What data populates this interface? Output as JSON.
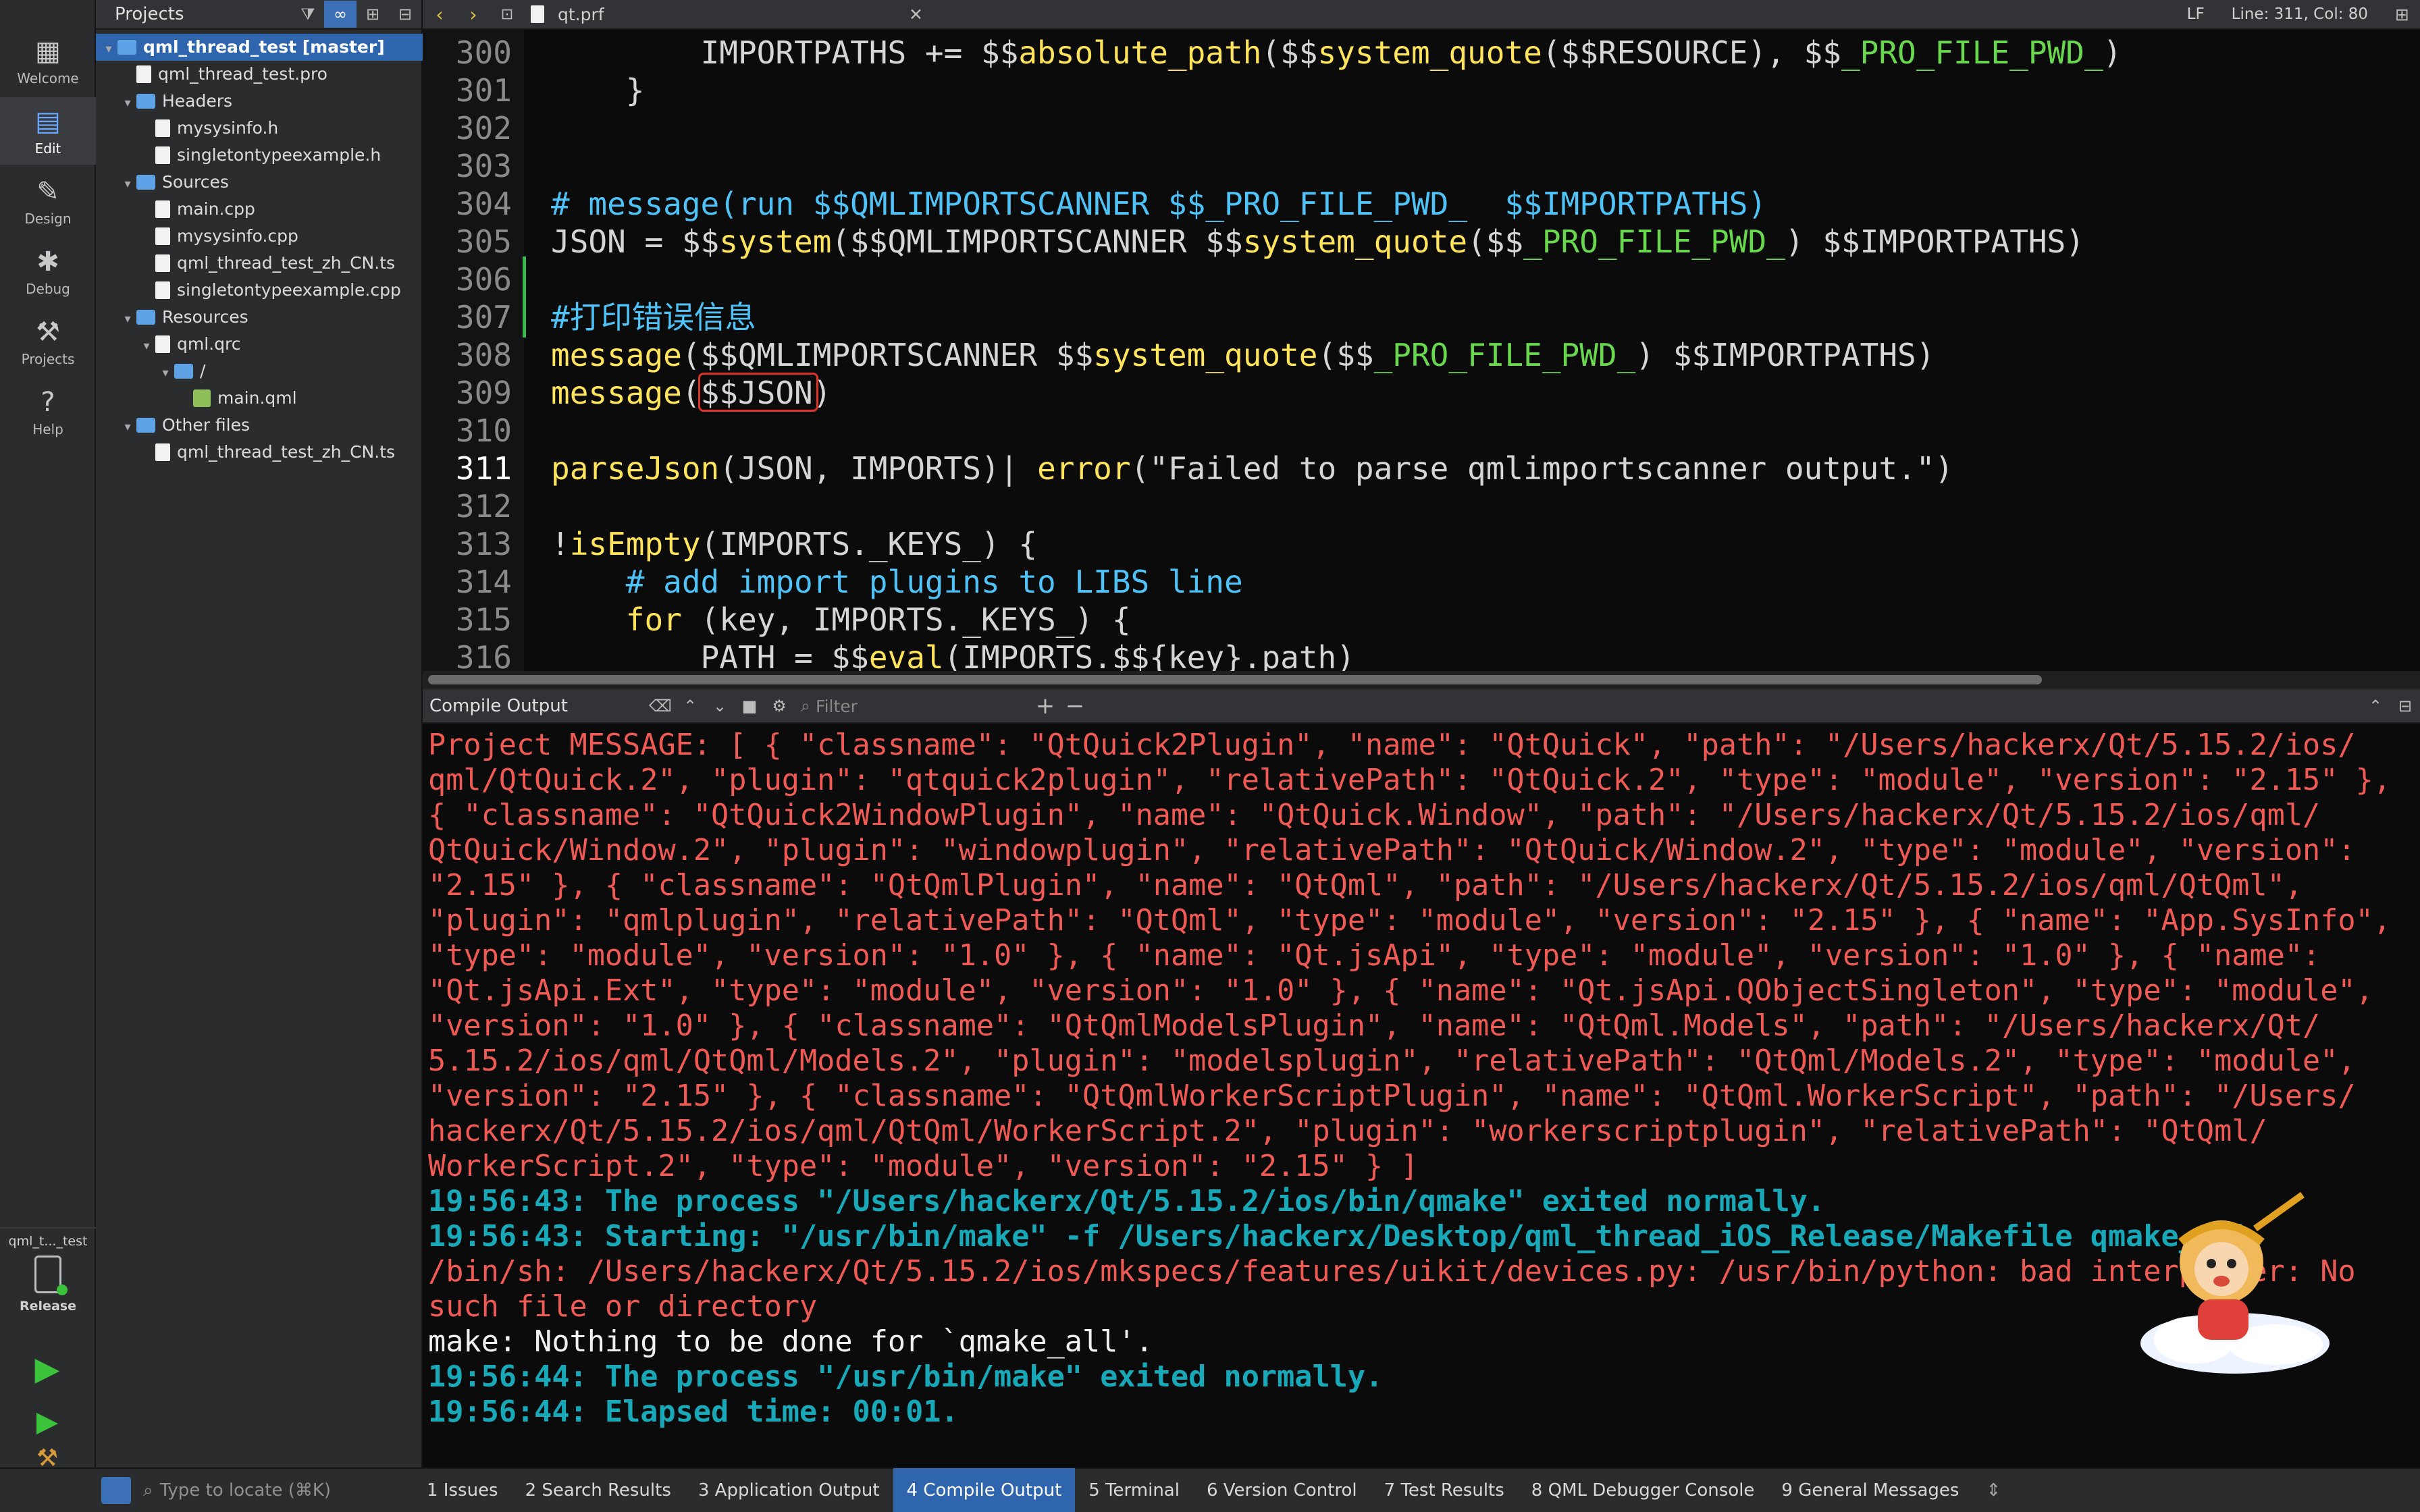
{
  "modes": [
    {
      "label": "Welcome",
      "icon": "grid-icon"
    },
    {
      "label": "Edit",
      "icon": "edit-icon"
    },
    {
      "label": "Design",
      "icon": "pen-icon"
    },
    {
      "label": "Debug",
      "icon": "bug-icon"
    },
    {
      "label": "Projects",
      "icon": "wrench-icon"
    },
    {
      "label": "Help",
      "icon": "help-icon"
    }
  ],
  "target": {
    "name": "qml_t..._test",
    "config": "Release"
  },
  "sidebar": {
    "title": "Projects",
    "tree": [
      {
        "label": "qml_thread_test [master]",
        "kind": "project",
        "depth": 0,
        "arrow": "▾"
      },
      {
        "label": "qml_thread_test.pro",
        "kind": "file",
        "depth": 1,
        "arrow": ""
      },
      {
        "label": "Headers",
        "kind": "folder",
        "depth": 1,
        "arrow": "▾"
      },
      {
        "label": "mysysinfo.h",
        "kind": "file",
        "depth": 2,
        "arrow": ""
      },
      {
        "label": "singletontypeexample.h",
        "kind": "file",
        "depth": 2,
        "arrow": ""
      },
      {
        "label": "Sources",
        "kind": "folder",
        "depth": 1,
        "arrow": "▾"
      },
      {
        "label": "main.cpp",
        "kind": "file",
        "depth": 2,
        "arrow": ""
      },
      {
        "label": "mysysinfo.cpp",
        "kind": "file",
        "depth": 2,
        "arrow": ""
      },
      {
        "label": "qml_thread_test_zh_CN.ts",
        "kind": "file",
        "depth": 2,
        "arrow": ""
      },
      {
        "label": "singletontypeexample.cpp",
        "kind": "file",
        "depth": 2,
        "arrow": ""
      },
      {
        "label": "Resources",
        "kind": "folder",
        "depth": 1,
        "arrow": "▾"
      },
      {
        "label": "qml.qrc",
        "kind": "file",
        "depth": 2,
        "arrow": "▾"
      },
      {
        "label": "/",
        "kind": "folder",
        "depth": 3,
        "arrow": "▾"
      },
      {
        "label": "main.qml",
        "kind": "qml",
        "depth": 4,
        "arrow": ""
      },
      {
        "label": "Other files",
        "kind": "folder",
        "depth": 1,
        "arrow": "▾"
      },
      {
        "label": "qml_thread_test_zh_CN.ts",
        "kind": "file",
        "depth": 2,
        "arrow": ""
      }
    ]
  },
  "editor": {
    "filename": "qt.prf",
    "encoding": "LF",
    "position": "Line: 311, Col: 80",
    "lines": [
      {
        "num": "300",
        "parts": [
          [
            "st",
            "        IMPORTPATHS += $$"
          ],
          [
            "kw",
            "absolute_path"
          ],
          [
            "st",
            "($$"
          ],
          [
            "kw",
            "system_quote"
          ],
          [
            "st",
            "($$RESOURCE), $$"
          ],
          [
            "gr",
            "_PRO_FILE_PWD_"
          ],
          [
            "st",
            ")"
          ]
        ]
      },
      {
        "num": "301",
        "parts": [
          [
            "st",
            "    }"
          ]
        ]
      },
      {
        "num": "302",
        "parts": []
      },
      {
        "num": "303",
        "parts": []
      },
      {
        "num": "304",
        "parts": [
          [
            "cm",
            "# message(run $$QMLIMPORTSCANNER $$_PRO_FILE_PWD_  $$IMPORTPATHS)"
          ]
        ]
      },
      {
        "num": "305",
        "parts": [
          [
            "st",
            "JSON = $$"
          ],
          [
            "kw",
            "system"
          ],
          [
            "st",
            "($$QMLIMPORTSCANNER $$"
          ],
          [
            "kw",
            "system_quote"
          ],
          [
            "st",
            "($$"
          ],
          [
            "gr",
            "_PRO_FILE_PWD_"
          ],
          [
            "st",
            ") $$IMPORTPATHS)"
          ]
        ]
      },
      {
        "num": "306",
        "parts": []
      },
      {
        "num": "307",
        "parts": [
          [
            "cm",
            "#打印错误信息"
          ]
        ]
      },
      {
        "num": "308",
        "parts": [
          [
            "kw",
            "message"
          ],
          [
            "st",
            "($$QMLIMPORTSCANNER $$"
          ],
          [
            "kw",
            "system_quote"
          ],
          [
            "st",
            "($$"
          ],
          [
            "gr",
            "_PRO_FILE_PWD_"
          ],
          [
            "st",
            ") $$IMPORTPATHS)"
          ]
        ]
      },
      {
        "num": "309",
        "parts": [
          [
            "kw",
            "message"
          ],
          [
            "st",
            "($$JSON)"
          ]
        ]
      },
      {
        "num": "310",
        "parts": []
      },
      {
        "num": "311",
        "parts": [
          [
            "kw",
            "parseJson"
          ],
          [
            "st",
            "(JSON, IMPORTS)| "
          ],
          [
            "kw",
            "error"
          ],
          [
            "st",
            "(\"Failed to parse qmlimportscanner output.\")"
          ]
        ]
      },
      {
        "num": "312",
        "parts": []
      },
      {
        "num": "313",
        "parts": [
          [
            "st",
            "!"
          ],
          [
            "kw",
            "isEmpty"
          ],
          [
            "st",
            "(IMPORTS._KEYS_) {"
          ]
        ]
      },
      {
        "num": "314",
        "parts": [
          [
            "cm",
            "    # add import plugins to LIBS line"
          ]
        ]
      },
      {
        "num": "315",
        "parts": [
          [
            "kw",
            "    for"
          ],
          [
            "st",
            " (key, IMPORTS._KEYS_) {"
          ]
        ]
      },
      {
        "num": "316",
        "parts": [
          [
            "st",
            "        PATH = $$"
          ],
          [
            "kw",
            "eval"
          ],
          [
            "st",
            "(IMPORTS.$${key}.path)"
          ]
        ]
      }
    ]
  },
  "output": {
    "title": "Compile Output",
    "filter_placeholder": "Filter",
    "lines": [
      {
        "cls": "red",
        "text": "Project MESSAGE: [ { \"classname\": \"QtQuick2Plugin\", \"name\": \"QtQuick\", \"path\": \"/Users/hackerx/Qt/5.15.2/ios/"
      },
      {
        "cls": "red",
        "text": "qml/QtQuick.2\", \"plugin\": \"qtquick2plugin\", \"relativePath\": \"QtQuick.2\", \"type\": \"module\", \"version\": \"2.15\" },"
      },
      {
        "cls": "red",
        "text": "{ \"classname\": \"QtQuick2WindowPlugin\", \"name\": \"QtQuick.Window\", \"path\": \"/Users/hackerx/Qt/5.15.2/ios/qml/"
      },
      {
        "cls": "red",
        "text": "QtQuick/Window.2\", \"plugin\": \"windowplugin\", \"relativePath\": \"QtQuick/Window.2\", \"type\": \"module\", \"version\":"
      },
      {
        "cls": "red",
        "text": "\"2.15\" }, { \"classname\": \"QtQmlPlugin\", \"name\": \"QtQml\", \"path\": \"/Users/hackerx/Qt/5.15.2/ios/qml/QtQml\","
      },
      {
        "cls": "red",
        "text": "\"plugin\": \"qmlplugin\", \"relativePath\": \"QtQml\", \"type\": \"module\", \"version\": \"2.15\" }, { \"name\": \"App.SysInfo\","
      },
      {
        "cls": "red",
        "text": "\"type\": \"module\", \"version\": \"1.0\" }, { \"name\": \"Qt.jsApi\", \"type\": \"module\", \"version\": \"1.0\" }, { \"name\":"
      },
      {
        "cls": "red",
        "text": "\"Qt.jsApi.Ext\", \"type\": \"module\", \"version\": \"1.0\" }, { \"name\": \"Qt.jsApi.QObjectSingleton\", \"type\": \"module\","
      },
      {
        "cls": "red",
        "text": "\"version\": \"1.0\" }, { \"classname\": \"QtQmlModelsPlugin\", \"name\": \"QtQml.Models\", \"path\": \"/Users/hackerx/Qt/"
      },
      {
        "cls": "red",
        "text": "5.15.2/ios/qml/QtQml/Models.2\", \"plugin\": \"modelsplugin\", \"relativePath\": \"QtQml/Models.2\", \"type\": \"module\","
      },
      {
        "cls": "red",
        "text": "\"version\": \"2.15\" }, { \"classname\": \"QtQmlWorkerScriptPlugin\", \"name\": \"QtQml.WorkerScript\", \"path\": \"/Users/"
      },
      {
        "cls": "red",
        "text": "hackerx/Qt/5.15.2/ios/qml/QtQml/WorkerScript.2\", \"plugin\": \"workerscriptplugin\", \"relativePath\": \"QtQml/"
      },
      {
        "cls": "red",
        "text": "WorkerScript.2\", \"type\": \"module\", \"version\": \"2.15\" } ]"
      },
      {
        "cls": "teal",
        "text": "19:56:43: The process \"/Users/hackerx/Qt/5.15.2/ios/bin/qmake\" exited normally."
      },
      {
        "cls": "teal",
        "text": "19:56:43: Starting: \"/usr/bin/make\" -f /Users/hackerx/Desktop/qml_thread_iOS_Release/Makefile qmake_all"
      },
      {
        "cls": "red",
        "text": "/bin/sh: /Users/hackerx/Qt/5.15.2/ios/mkspecs/features/uikit/devices.py: /usr/bin/python: bad interpreter: No"
      },
      {
        "cls": "red",
        "text": "such file or directory"
      },
      {
        "cls": "white",
        "text": "make: Nothing to be done for `qmake_all'."
      },
      {
        "cls": "teal",
        "text": "19:56:44: The process \"/usr/bin/make\" exited normally."
      },
      {
        "cls": "teal",
        "text": "19:56:44: Elapsed time: 00:01."
      }
    ]
  },
  "statusbar": {
    "locate_placeholder": "Type to locate (⌘K)",
    "tabs": [
      {
        "label": "1  Issues",
        "active": false
      },
      {
        "label": "2  Search Results",
        "active": false
      },
      {
        "label": "3  Application Output",
        "active": false
      },
      {
        "label": "4  Compile Output",
        "active": true
      },
      {
        "label": "5  Terminal",
        "active": false
      },
      {
        "label": "6  Version Control",
        "active": false
      },
      {
        "label": "7  Test Results",
        "active": false
      },
      {
        "label": "8  QML Debugger Console",
        "active": false
      },
      {
        "label": "9  General Messages",
        "active": false
      }
    ]
  },
  "colors": {
    "accent": "#2f65ad",
    "keyword": "#ffe45c",
    "comment": "#4fc3f7",
    "builtin_var": "#69d84f",
    "error_text": "#f05a55",
    "info_text": "#19a8b8",
    "highlight_box": "#e0342b"
  }
}
